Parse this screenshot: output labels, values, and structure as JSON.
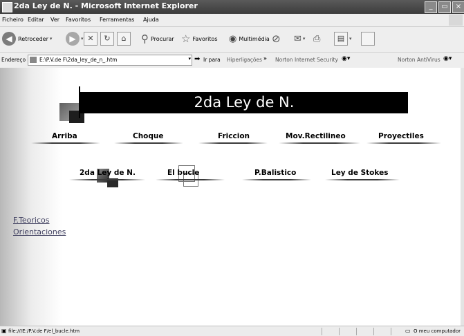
{
  "window": {
    "title": "2da Ley de N. - Microsoft Internet Explorer",
    "controls": [
      "_",
      "▭",
      "×"
    ]
  },
  "menu": [
    "Ficheiro",
    "Editar",
    "Ver",
    "Favoritos",
    "Ferramentas",
    "Ajuda"
  ],
  "toolbar": {
    "back": "Retroceder",
    "search": "Procurar",
    "favorites": "Favoritos",
    "media": "Multimédia"
  },
  "addressbar": {
    "label": "Endereço",
    "value": "E:\\P.V.de F\\2da_ley_de_n_.htm",
    "go": "Ir para",
    "links": "Hiperligações",
    "norton_is": "Norton Internet Security",
    "norton_av": "Norton AntiVirus"
  },
  "page": {
    "banner": "2da Ley de N.",
    "nav_row1": [
      "Arriba",
      "Choque",
      "Friccion",
      "Mov.Rectilineo",
      "Proyectiles"
    ],
    "nav_row2": [
      "2da Ley de N.",
      "El bucle",
      "P.Balistico",
      "Ley de Stokes"
    ],
    "side_links": [
      "F.Teoricos",
      "Orientaciones"
    ]
  },
  "statusbar": {
    "url": "file:///E:/P.V.de F/el_bucle.htm",
    "zone": "O meu computador"
  }
}
